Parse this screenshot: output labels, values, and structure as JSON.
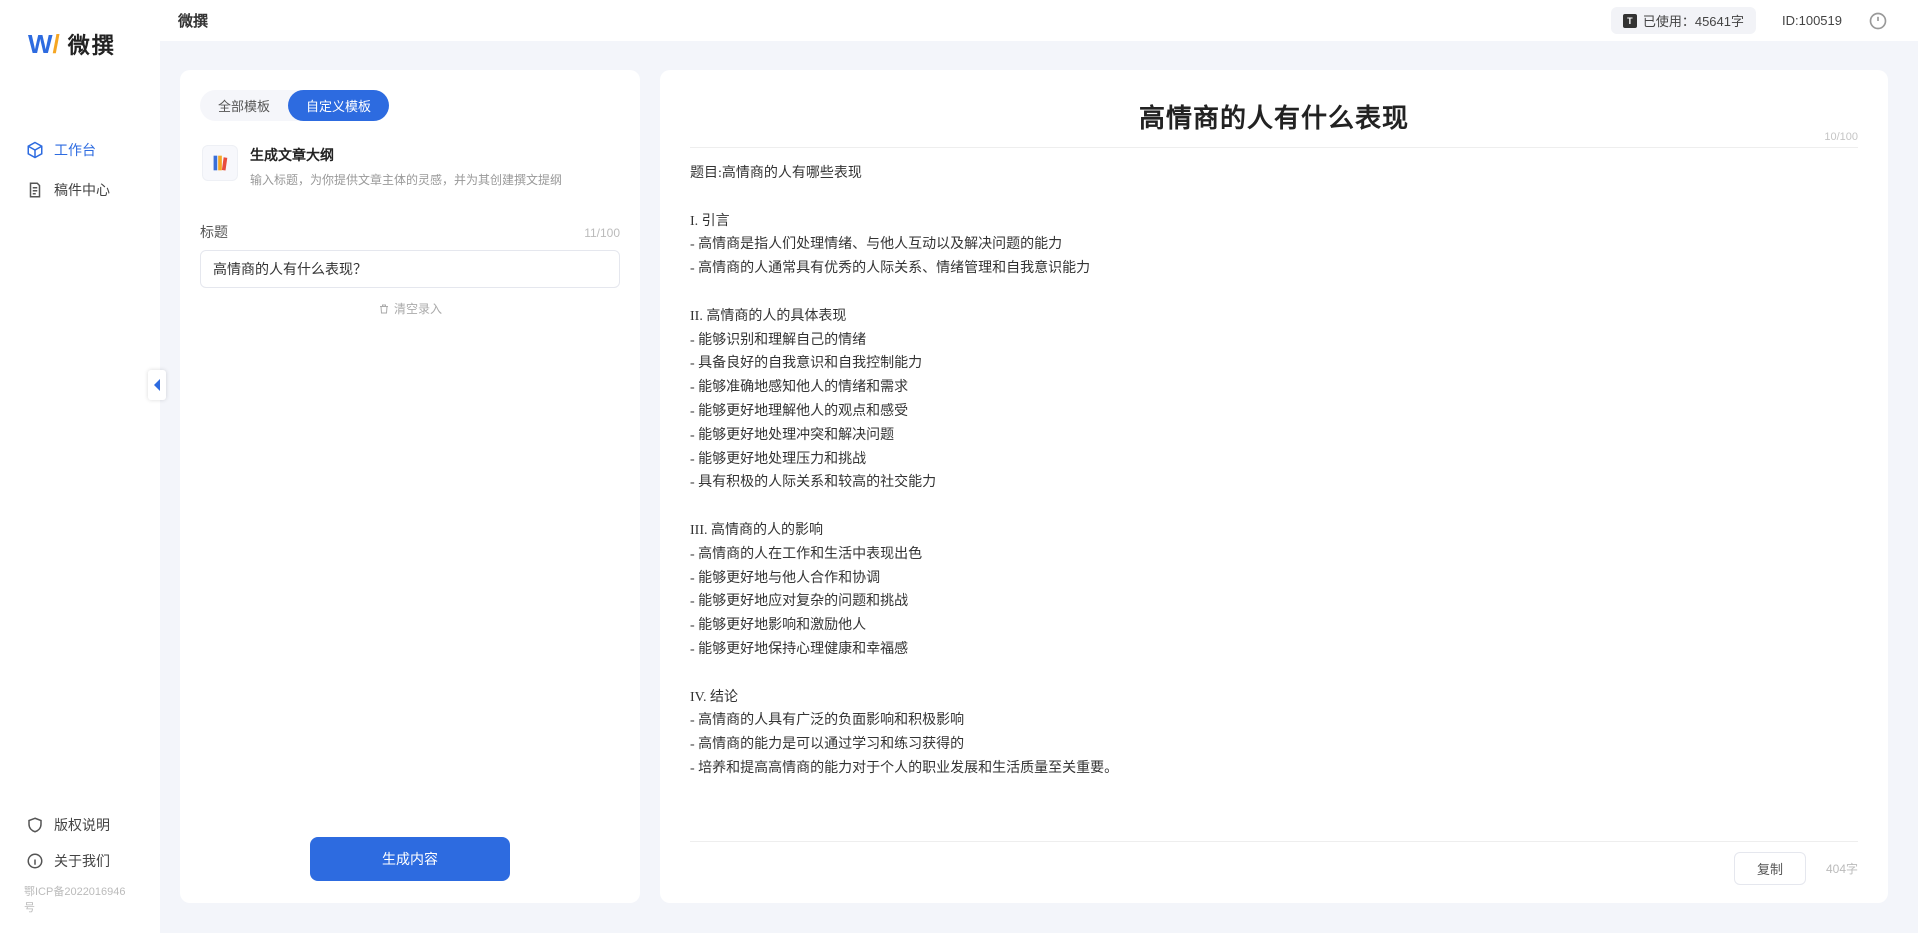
{
  "app": {
    "name": "微撰",
    "logo_text": "微撰"
  },
  "sidebar": {
    "items": [
      {
        "label": "工作台"
      },
      {
        "label": "稿件中心"
      }
    ],
    "bottom": [
      {
        "label": "版权说明"
      },
      {
        "label": "关于我们"
      }
    ],
    "icp": "鄂ICP备2022016946号"
  },
  "header": {
    "usage_label": "已使用：45641字",
    "user_id": "ID:100519"
  },
  "left": {
    "tabs": [
      {
        "label": "全部模板"
      },
      {
        "label": "自定义模板"
      }
    ],
    "template": {
      "title": "生成文章大纲",
      "desc": "输入标题，为你提供文章主体的灵感，并为其创建撰文提纲"
    },
    "field_label": "标题",
    "counter": "11/100",
    "title_value": "高情商的人有什么表现？",
    "clear_label": "清空录入",
    "generate": "生成内容"
  },
  "doc": {
    "title": "高情商的人有什么表现",
    "title_counter": "10/100",
    "body": "题目:高情商的人有哪些表现\n\nI. 引言\n- 高情商是指人们处理情绪、与他人互动以及解决问题的能力\n- 高情商的人通常具有优秀的人际关系、情绪管理和自我意识能力\n\nII. 高情商的人的具体表现\n- 能够识别和理解自己的情绪\n- 具备良好的自我意识和自我控制能力\n- 能够准确地感知他人的情绪和需求\n- 能够更好地理解他人的观点和感受\n- 能够更好地处理冲突和解决问题\n- 能够更好地处理压力和挑战\n- 具有积极的人际关系和较高的社交能力\n\nIII. 高情商的人的影响\n- 高情商的人在工作和生活中表现出色\n- 能够更好地与他人合作和协调\n- 能够更好地应对复杂的问题和挑战\n- 能够更好地影响和激励他人\n- 能够更好地保持心理健康和幸福感\n\nIV. 结论\n- 高情商的人具有广泛的负面影响和积极影响\n- 高情商的能力是可以通过学习和练习获得的\n- 培养和提高高情商的能力对于个人的职业发展和生活质量至关重要。",
    "copy": "复制",
    "word_count": "404字"
  }
}
